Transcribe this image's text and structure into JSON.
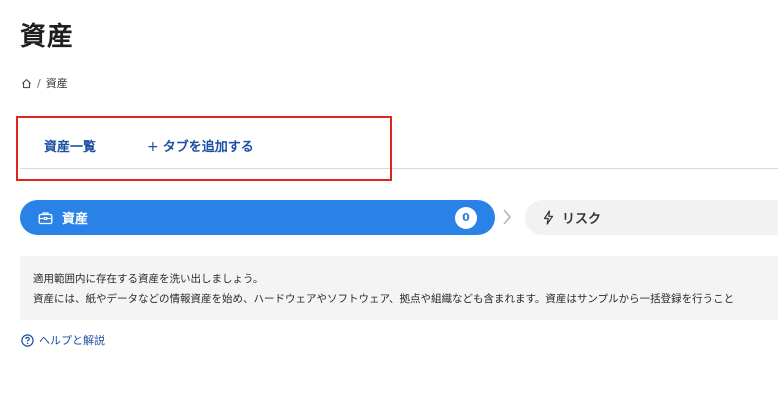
{
  "page": {
    "title": "資産"
  },
  "breadcrumb": {
    "home_icon": "home-icon",
    "separator": "/",
    "current": "資産"
  },
  "tabs": {
    "assets_list": "資産一覧",
    "add_tab_plus": "+",
    "add_tab": "タブを追加する"
  },
  "steps": [
    {
      "icon": "briefcase-icon",
      "label": "資産",
      "count": "0",
      "active": true
    },
    {
      "icon": "lightning-icon",
      "label": "リスク",
      "active": false
    }
  ],
  "info": {
    "line1": "適用範囲内に存在する資産を洗い出しましょう。",
    "line2": "資産には、紙やデータなどの情報資産を始め、ハードウェアやソフトウェア、拠点や組織なども含まれます。資産はサンプルから一括登録を行うこと"
  },
  "help": {
    "icon": "question-circle-icon",
    "label": "ヘルプと解説"
  },
  "colors": {
    "accent": "#2a82e6",
    "link": "#1c4fa3",
    "highlight_border": "#e0261b",
    "info_bg": "#f4f4f4"
  }
}
